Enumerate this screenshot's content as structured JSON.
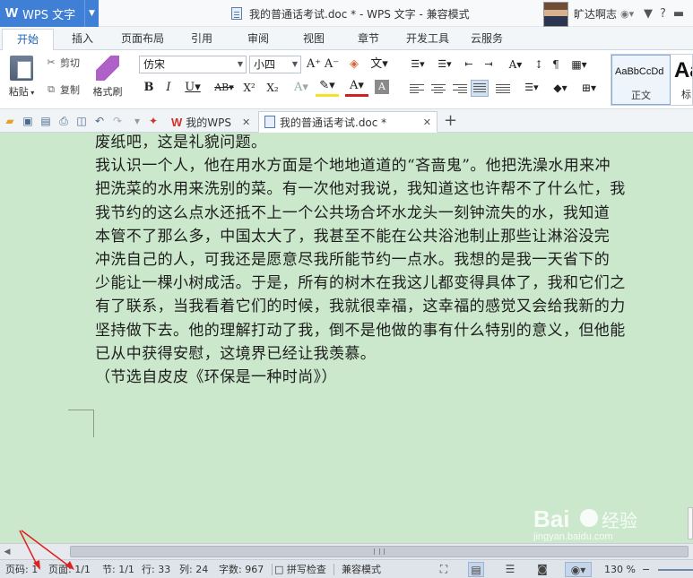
{
  "titlebar": {
    "app_name": "WPS 文字",
    "doc_title": "我的普通话考试.doc * - WPS 文字 - 兼容模式",
    "user_name": "旷达啊志"
  },
  "ribbon_tabs": [
    "开始",
    "插入",
    "页面布局",
    "引用",
    "审阅",
    "视图",
    "章节",
    "开发工具",
    "云服务"
  ],
  "clipboard": {
    "paste": "粘贴",
    "cut": "剪切",
    "copy": "复制",
    "format_painter": "格式刷"
  },
  "font": {
    "family": "仿宋",
    "size": "小四"
  },
  "styles": {
    "normal_sample": "AaBbCcDd",
    "normal_name": "正文",
    "heading_sample": "Aa",
    "heading_name": "标"
  },
  "doc_tabs": {
    "home_tab": "我的WPS",
    "doc_tab": "我的普通话考试.doc *"
  },
  "document": {
    "lines": [
      "废纸吧，这是礼貌问题。",
      "我认识一个人，他在用水方面是个地地道道的“吝啬鬼”。他把洗澡水用来冲",
      "把洗菜的水用来洗别的菜。有一次他对我说，我知道这也许帮不了什么忙，我",
      "我节约的这么点水还抵不上一个公共场合坏水龙头一刻钟流失的水，我知道",
      "本管不了那么多，中国太大了，我甚至不能在公共浴池制止那些让淋浴没完",
      "冲洗自己的人，可我还是愿意尽我所能节约一点水。我想的是我一天省下的",
      "少能让一棵小树成活。于是，所有的树木在我这儿都变得具体了，我和它们之",
      "有了联系，当我看着它们的时候，我就很幸福，这幸福的感觉又会给我新的力",
      "坚持做下去。他的理解打动了我，倒不是他做的事有什么特别的意义，但他能",
      "已从中获得安慰，这境界已经让我羡慕。",
      "（节选自皮皮《环保是一种时尚》）"
    ]
  },
  "statusbar": {
    "page_code": "页码: 1",
    "pages": "页面: 1/1",
    "section": "节: 1/1",
    "row": "行: 33",
    "col": "列: 24",
    "word_count": "字数: 967",
    "spell_check": "拼写检查",
    "compat_mode": "兼容模式",
    "zoom": "130 %"
  },
  "colors": {
    "accent": "#3f7fd6",
    "doc_background": "#cbe8cc",
    "annotation_arrow": "#e02020"
  },
  "watermark": "Bai 经验 jingyan.baidu.com"
}
